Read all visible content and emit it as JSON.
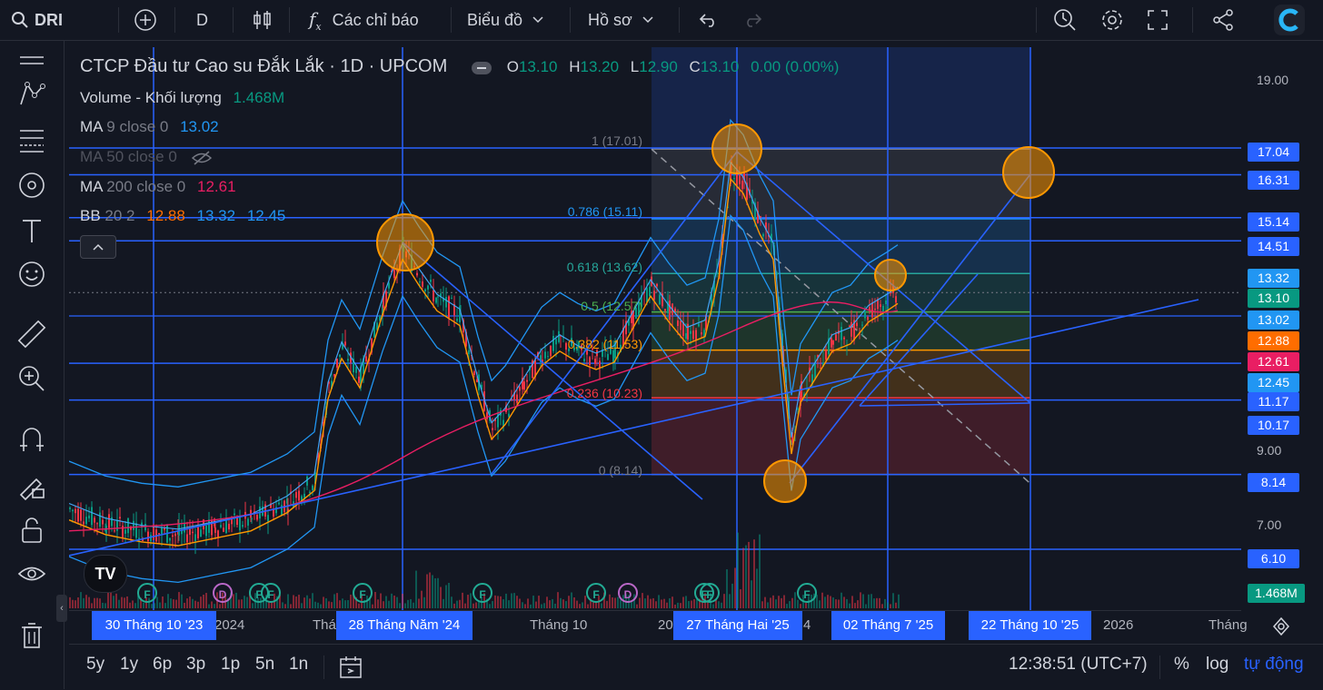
{
  "topbar": {
    "symbol": "DRI",
    "interval": "D",
    "indicators_label": "Các chỉ báo",
    "chart_menu": "Biểu đồ",
    "profile_menu": "Hồ sơ"
  },
  "legend": {
    "title": "CTCP Đầu tư Cao su Đắk Lắk · 1D · UPCOM",
    "o_label": "O",
    "o": "13.10",
    "h_label": "H",
    "h": "13.20",
    "l_label": "L",
    "l": "12.90",
    "c_label": "C",
    "c": "13.10",
    "change": "0.00 (0.00%)",
    "volume_label": "Volume - Khối lượng",
    "volume": "1.468M",
    "ma9_label": "MA",
    "ma9_params": "9 close 0",
    "ma9": "13.02",
    "ma50_label": "MA 50 close 0",
    "ma200_label": "MA",
    "ma200_params": "200 close 0",
    "ma200": "12.61",
    "bb_label": "BB",
    "bb_params": "20 2",
    "bb_mid": "12.88",
    "bb_up": "13.32",
    "bb_low": "12.45"
  },
  "fib": [
    {
      "label": "1 (17.01)",
      "color": "#787b86"
    },
    {
      "label": "0.786 (15.11)",
      "color": "#2196f3"
    },
    {
      "label": "0.618 (13.62)",
      "color": "#26a69a"
    },
    {
      "label": "0.5 (12.57)",
      "color": "#4caf50"
    },
    {
      "label": "0.382 (11.53)",
      "color": "#ff9800"
    },
    {
      "label": "0.236 (10.23)",
      "color": "#f23645"
    },
    {
      "label": "0 (8.14)",
      "color": "#787b86"
    }
  ],
  "yaxis": {
    "labels": [
      "19.00",
      "9.00",
      "7.00"
    ],
    "tags": [
      {
        "v": "17.04",
        "color": "#2962ff"
      },
      {
        "v": "16.31",
        "color": "#2962ff"
      },
      {
        "v": "15.14",
        "color": "#2962ff"
      },
      {
        "v": "14.51",
        "color": "#2962ff"
      },
      {
        "v": "13.32",
        "color": "#2196f3"
      },
      {
        "v": "13.10",
        "color": "#089981"
      },
      {
        "v": "13.02",
        "color": "#2196f3"
      },
      {
        "v": "12.88",
        "color": "#ff6d00"
      },
      {
        "v": "12.61",
        "color": "#e91e63"
      },
      {
        "v": "12.45",
        "color": "#2196f3"
      },
      {
        "v": "11.17",
        "color": "#2962ff"
      },
      {
        "v": "10.17",
        "color": "#2962ff"
      },
      {
        "v": "8.14",
        "color": "#2962ff"
      },
      {
        "v": "6.10",
        "color": "#2962ff"
      },
      {
        "v": "1.468M",
        "color": "#089981"
      }
    ]
  },
  "xaxis": {
    "labels": [
      "2024",
      "Thá",
      "Tháng 10",
      "20",
      "4",
      "2026",
      "Tháng"
    ],
    "tags": [
      "30 Tháng 10 '23",
      "28 Tháng Năm '24",
      "27 Tháng Hai '25",
      "02 Tháng 7 '25",
      "22 Tháng 10 '25"
    ]
  },
  "events": [
    "F",
    "D",
    "F",
    "F",
    "F",
    "F",
    "F",
    "D",
    "F",
    "F",
    "F"
  ],
  "bottombar": {
    "ranges": [
      "5y",
      "1y",
      "6p",
      "3p",
      "1p",
      "5n",
      "1n"
    ],
    "time": "12:38:51 (UTC+7)",
    "percent": "%",
    "log": "log",
    "auto": "tự động"
  },
  "colors": {
    "accent": "#2962ff",
    "up": "#089981",
    "down": "#f23645",
    "bg": "#131722"
  },
  "icons": [
    "plus-icon",
    "indicator-compare-icon",
    "fx-icon",
    "undo-icon",
    "redo-icon",
    "alert-icon",
    "gear-icon",
    "fullscreen-icon",
    "share-icon",
    "logo-icon"
  ]
}
